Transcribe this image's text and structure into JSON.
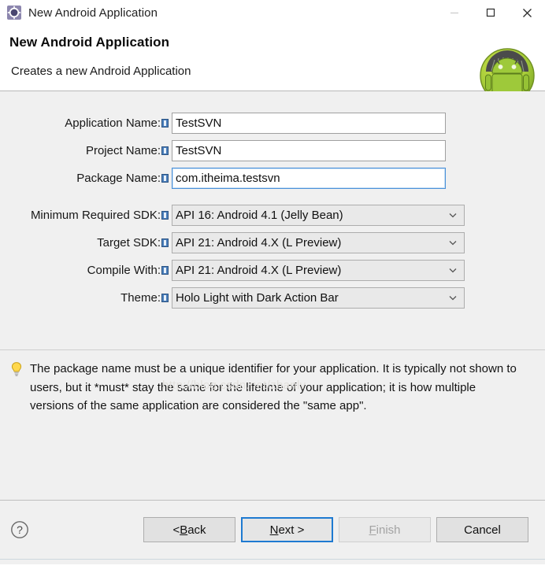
{
  "window": {
    "title": "New Android Application",
    "icon": "android-wizard-icon",
    "controls": [
      {
        "name": "minimize-button",
        "glyph": "—",
        "enabled": false
      },
      {
        "name": "maximize-button",
        "glyph": "□",
        "enabled": true
      },
      {
        "name": "close-button",
        "glyph": "✕",
        "enabled": true
      }
    ]
  },
  "header": {
    "title": "New Android Application",
    "description": "Creates a new Android Application",
    "logo": "android-robot-logo"
  },
  "watermark": "http://blog.csdn.net/zhanlv",
  "form": {
    "text_fields": [
      {
        "name": "application-name",
        "label": "Application Name:",
        "value": "TestSVN",
        "placeholder": "",
        "focused": false,
        "info_icon": "info-icon"
      },
      {
        "name": "project-name",
        "label": "Project Name:",
        "value": "TestSVN",
        "placeholder": "",
        "focused": false,
        "info_icon": "info-icon"
      },
      {
        "name": "package-name",
        "label": "Package Name:",
        "value": "com.itheima.testsvn",
        "placeholder": "",
        "focused": true,
        "info_icon": "info-icon"
      }
    ],
    "combos": [
      {
        "name": "minimum-required-sdk",
        "label": "Minimum Required SDK:",
        "value": "API 16: Android 4.1 (Jelly Bean)",
        "info_icon": "info-icon",
        "chevron": "chevron-down-icon"
      },
      {
        "name": "target-sdk",
        "label": "Target SDK:",
        "value": "API 21: Android 4.X (L Preview)",
        "info_icon": "info-icon",
        "chevron": "chevron-down-icon"
      },
      {
        "name": "compile-with",
        "label": "Compile With:",
        "value": "API 21: Android 4.X (L Preview)",
        "info_icon": "info-icon",
        "chevron": "chevron-down-icon"
      },
      {
        "name": "theme",
        "label": "Theme:",
        "value": "Holo Light with Dark Action Bar",
        "info_icon": "info-icon",
        "chevron": "chevron-down-icon"
      }
    ]
  },
  "hint": {
    "icon": "lightbulb-icon",
    "text": "The package name must be a unique identifier for your application. It is typically not shown to users, but it *must* stay the same for the lifetime of your application; it is how multiple versions of the same application are considered the \"same app\"."
  },
  "footer": {
    "help_icon": "help-question-icon",
    "buttons": [
      {
        "name": "back-button",
        "pre": "< ",
        "mnemonic": "B",
        "post": "ack",
        "enabled": true,
        "default": false
      },
      {
        "name": "next-button",
        "pre": "",
        "mnemonic": "N",
        "post": "ext >",
        "enabled": true,
        "default": true
      },
      {
        "name": "finish-button",
        "pre": "",
        "mnemonic": "F",
        "post": "inish",
        "enabled": false,
        "default": false
      },
      {
        "name": "cancel-button",
        "pre": "",
        "mnemonic": "",
        "post": "Cancel",
        "enabled": true,
        "default": false
      }
    ]
  },
  "colors": {
    "dialog_bg": "#f0f0f0",
    "header_bg": "#ffffff",
    "accent_blue": "#1e7ad1",
    "focus_border": "#4a90d9",
    "android_green": "#a4c639"
  }
}
